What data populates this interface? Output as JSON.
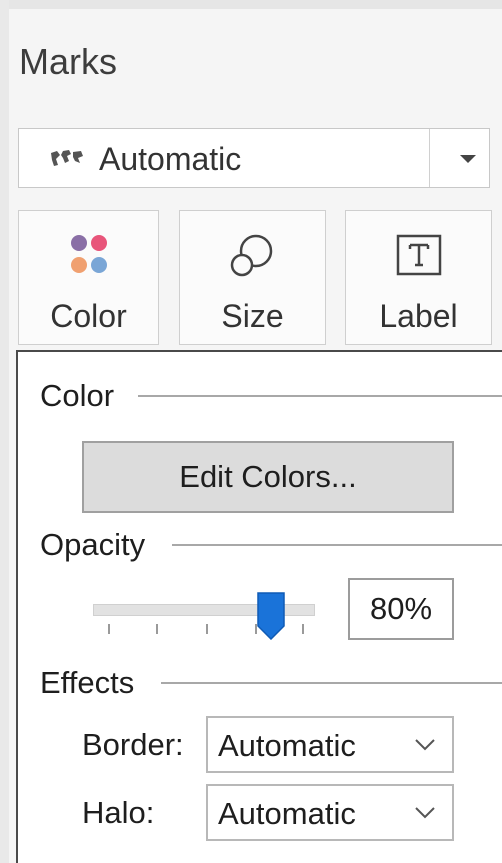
{
  "panel": {
    "title": "Marks"
  },
  "mark_type": {
    "icon": "map-icon",
    "value": "Automatic",
    "dropdown_icon": "chevron-down-icon"
  },
  "shelves": [
    {
      "label": "Color",
      "icon": "color-dots-icon"
    },
    {
      "label": "Size",
      "icon": "size-circles-icon"
    },
    {
      "label": "Label",
      "icon": "text-label-icon"
    }
  ],
  "popover": {
    "color_title": "Color",
    "edit_colors": "Edit Colors...",
    "opacity_title": "Opacity",
    "opacity_value": "80%",
    "opacity_level": 0.8,
    "effects_title": "Effects",
    "border_label": "Border:",
    "border_value": "Automatic",
    "halo_label": "Halo:",
    "halo_value": "Automatic"
  },
  "colors": {
    "accent": "#1a73d9",
    "dot_purple": "#8a6fa6",
    "dot_pink": "#e8557a",
    "dot_orange": "#f0a070",
    "dot_blue": "#7aa6d6"
  }
}
